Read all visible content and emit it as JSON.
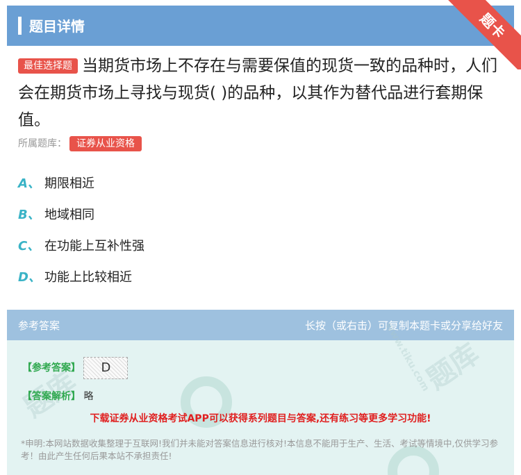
{
  "header": {
    "title": "题目详情",
    "ribbon_label": "题卡"
  },
  "question": {
    "tag": "最佳选择题",
    "text": "当期货市场上不存在与需要保值的现货一致的品种时，人们会在期货市场上寻找与现货( )的品种，以其作为替代品进行套期保值。"
  },
  "source": {
    "label": "所属题库：",
    "bank": "证券从业资格"
  },
  "options": [
    {
      "letter": "A、",
      "text": "期限相近"
    },
    {
      "letter": "B、",
      "text": "地域相同"
    },
    {
      "letter": "C、",
      "text": "在功能上互补性强"
    },
    {
      "letter": "D、",
      "text": "功能上比较相近"
    }
  ],
  "answer": {
    "head_left": "参考答案",
    "head_right": "长按（或右击）可复制本题卡或分享给好友",
    "ref_label": "【参考答案】",
    "ref_value": "D",
    "analysis_label": "【答案解析】",
    "analysis_value": "略",
    "promo": "下载证券从业资格考试APP可以获得系列题目与答案,还有练习等更多学习功能!",
    "disclaimer": "*申明:本网站数据收集整理于互联网!我们并未能对答案信息进行核对!本信息不能用于生产、生活、考试等情境中,仅供学习参考！由此产生任何后果本站不承担责任!"
  },
  "watermark": {
    "text1": "www.tiku.com",
    "text2": "题库"
  }
}
